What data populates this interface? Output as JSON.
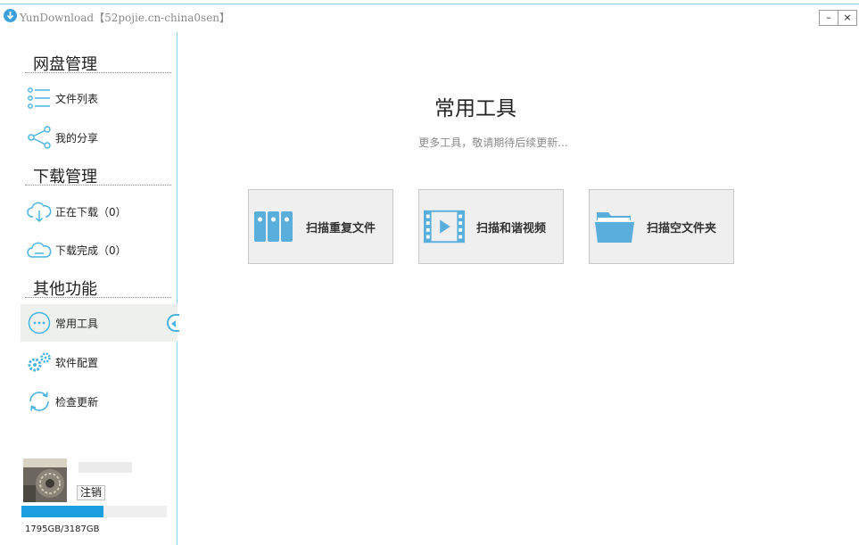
{
  "window": {
    "title": "YunDownload【52pojie.cn-china0sen】",
    "minimize_label": "–",
    "close_label": "×"
  },
  "sidebar": {
    "sections": [
      {
        "title": "网盘管理",
        "items": [
          {
            "label": "文件列表",
            "icon": "list-icon"
          },
          {
            "label": "我的分享",
            "icon": "share-icon"
          }
        ]
      },
      {
        "title": "下载管理",
        "items": [
          {
            "label": "正在下载（0）",
            "icon": "cloud-download-icon"
          },
          {
            "label": "下载完成（0）",
            "icon": "cloud-done-icon"
          }
        ]
      },
      {
        "title": "其他功能",
        "items": [
          {
            "label": "常用工具",
            "icon": "more-icon",
            "active": true
          },
          {
            "label": "软件配置",
            "icon": "gears-icon"
          },
          {
            "label": "检查更新",
            "icon": "refresh-icon"
          }
        ]
      }
    ]
  },
  "user": {
    "logout_label": "注销",
    "storage_used_fraction": 0.563,
    "storage_text": "1795GB/3187GB"
  },
  "main": {
    "title": "常用工具",
    "subtitle": "更多工具，敬请期待后续更新...",
    "tools": [
      {
        "label": "扫描重复文件",
        "icon": "binders-icon"
      },
      {
        "label": "扫描和谐视频",
        "icon": "video-icon"
      },
      {
        "label": "扫描空文件夹",
        "icon": "folder-icon"
      }
    ]
  },
  "colors": {
    "accent": "#4ab3e0",
    "storage_fill": "#1a9ee0",
    "divider": "#8fd3ec"
  }
}
